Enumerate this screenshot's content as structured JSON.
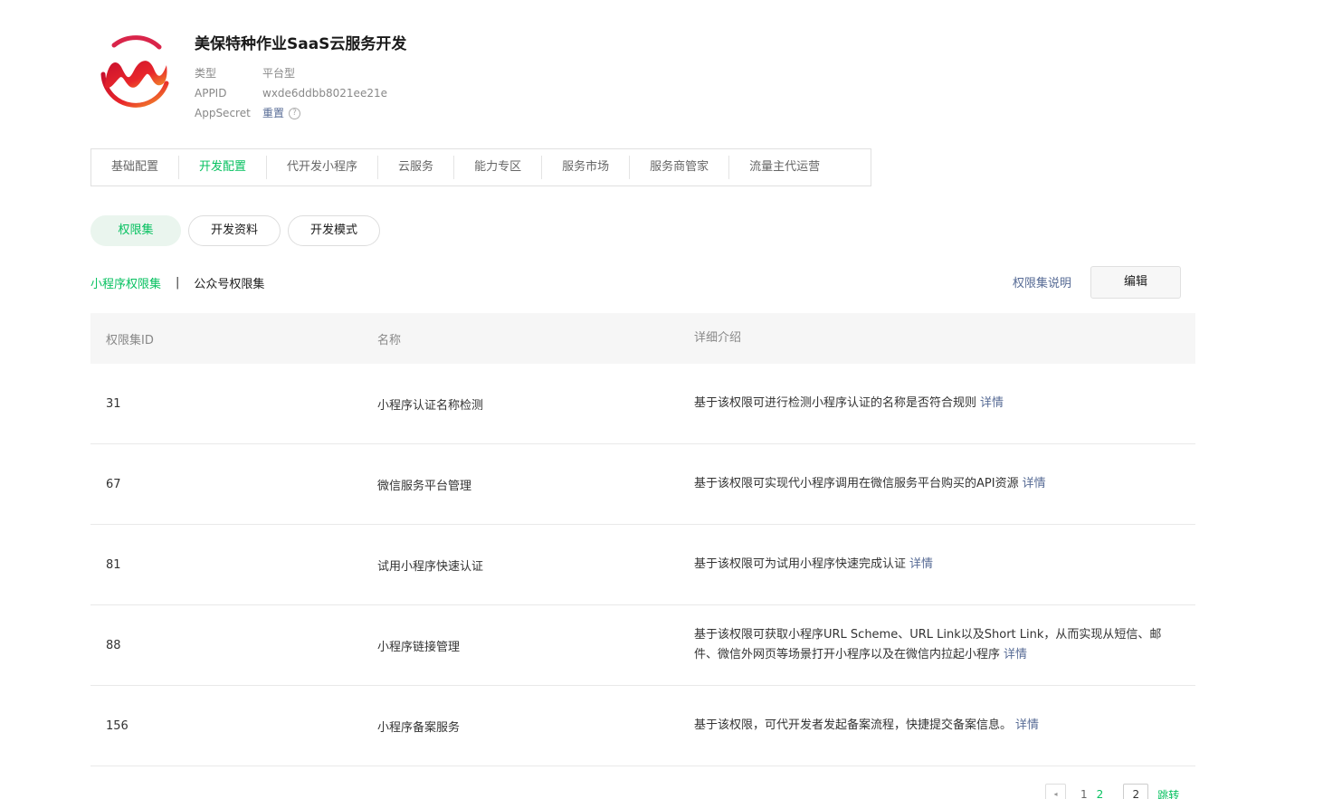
{
  "app": {
    "name": "美保特种作业SaaS云服务开发",
    "type_label": "类型",
    "type_value": "平台型",
    "appid_label": "APPID",
    "appid_value": "wxde6ddbb8021ee21e",
    "secret_label": "AppSecret",
    "secret_action": "重置",
    "help_icon": "?"
  },
  "colors": {
    "accent": "#07c160",
    "link": "#576b95",
    "logo_red": "#e8262b",
    "logo_orange": "#f39a2b"
  },
  "tabs": [
    {
      "label": "基础配置"
    },
    {
      "label": "开发配置"
    },
    {
      "label": "代开发小程序"
    },
    {
      "label": "云服务"
    },
    {
      "label": "能力专区"
    },
    {
      "label": "服务市场"
    },
    {
      "label": "服务商管家"
    },
    {
      "label": "流量主代运营"
    }
  ],
  "active_tab": "开发配置",
  "pills": [
    {
      "label": "权限集"
    },
    {
      "label": "开发资料"
    },
    {
      "label": "开发模式"
    }
  ],
  "subnav": {
    "miniprogram": "小程序权限集",
    "separator": "|",
    "official": "公众号权限集",
    "explain": "权限集说明",
    "edit": "编辑"
  },
  "table": {
    "headers": {
      "id": "权限集ID",
      "name": "名称",
      "desc": "详细介绍"
    },
    "detail_label": "详情",
    "rows": [
      {
        "id": "31",
        "name": "小程序认证名称检测",
        "desc": "基于该权限可进行检测小程序认证的名称是否符合规则"
      },
      {
        "id": "67",
        "name": "微信服务平台管理",
        "desc": "基于该权限可实现代小程序调用在微信服务平台购买的API资源"
      },
      {
        "id": "81",
        "name": "试用小程序快速认证",
        "desc": "基于该权限可为试用小程序快速完成认证"
      },
      {
        "id": "88",
        "name": "小程序链接管理",
        "desc": "基于该权限可获取小程序URL Scheme、URL Link以及Short Link，从而实现从短信、邮件、微信外网页等场景打开小程序以及在微信内拉起小程序"
      },
      {
        "id": "156",
        "name": "小程序备案服务",
        "desc": "基于该权限，可代开发者发起备案流程，快捷提交备案信息。"
      }
    ]
  },
  "pager": {
    "prev_icon": "◂",
    "page1": "1",
    "page2": "2",
    "input_value": "2",
    "jump": "跳转"
  }
}
